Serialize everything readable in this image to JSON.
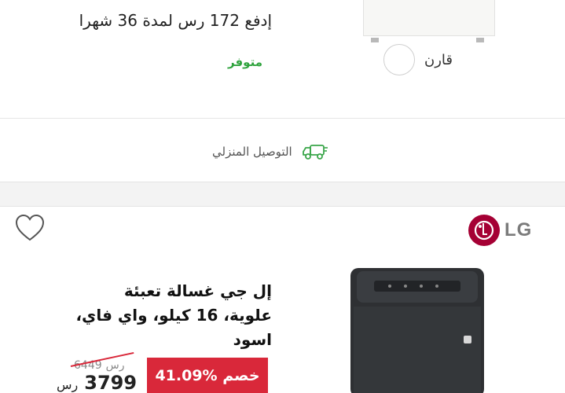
{
  "listing_1": {
    "installment_text": "إدفع 172 رس  لمدة 36 شهرا",
    "stock_status": "متوفر",
    "compare_label": "قارن",
    "delivery_label": "التوصيل المنزلي",
    "delivery_icon": "truck-icon"
  },
  "listing_2": {
    "brand_name": "LG",
    "title": "إل جي غسالة تعبئة علوية، 16 كيلو، واي فاي، اسود",
    "discount_label": "41.09% خصم",
    "old_price": "6449",
    "old_price_currency": "رس",
    "price": "3799",
    "price_currency": "رس",
    "wishlist_icon": "heart-icon",
    "colors": {
      "discount": "#d9283a",
      "stock": "#2fa33d",
      "brand": "#a50034"
    }
  }
}
